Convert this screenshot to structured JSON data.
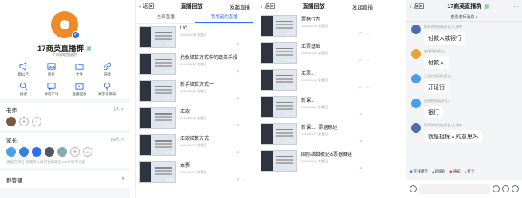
{
  "group_panel": {
    "name": "17商英直播群",
    "tag": "群",
    "subtitle": "17商英直播群",
    "tools": [
      {
        "label": "群公告",
        "icon": "megaphone-icon"
      },
      {
        "label": "图片",
        "icon": "image-icon"
      },
      {
        "label": "文件",
        "icon": "folder-icon"
      },
      {
        "label": "链接",
        "icon": "link-icon"
      },
      {
        "label": "搜索",
        "icon": "search-icon"
      },
      {
        "label": "群内广场",
        "icon": "chat-icon"
      },
      {
        "label": "直播回放",
        "icon": "video-icon"
      },
      {
        "label": "数字化教研",
        "icon": "bulb-icon"
      }
    ],
    "teachers": {
      "label": "老师",
      "count": "1人 >"
    },
    "parents": {
      "label": "家长",
      "count": "80人 >",
      "note": "该群已开启\"新成员入群可查看最近100条聊天记录\""
    },
    "manage": "群管理"
  },
  "replay_list": {
    "back": "返回",
    "title": "直播回放",
    "action": "发起直播",
    "tabs": [
      "全部直播",
      "我发起的直播"
    ],
    "items": [
      {
        "title": "L/C",
        "meta": "2020/03/25  查看回",
        "dur": "00:30"
      },
      {
        "title": "托收结算方式中的跟单手段",
        "meta": "2020/03/25  查看回",
        "dur": "00:41"
      },
      {
        "title": "新手结算方式一",
        "meta": "2020/03/25  查看回",
        "dur": "00:41"
      },
      {
        "title": "汇款",
        "meta": "2020/03/23  查看回",
        "dur": "00:24"
      },
      {
        "title": "汇款结算方式",
        "meta": "2020/03/23  查看回",
        "dur": "00:35"
      },
      {
        "title": "本票",
        "meta": "2020/03/20  查看回",
        "dur": "00:30"
      }
    ]
  },
  "replay_list2": {
    "back": "返回",
    "title": "直播回放",
    "action": "发起直播",
    "items": [
      {
        "title": "票据行为",
        "meta": "2020/03/19  查看回",
        "dur": "00:27"
      },
      {
        "title": "汇票基础",
        "meta": "2020/03/18  查看回",
        "dur": "00:31"
      },
      {
        "title": "汇票1",
        "meta": "2020/03/13  查看回",
        "dur": "00:43"
      },
      {
        "title": "新课1",
        "meta": "2020/03/12  查看回",
        "dur": "00:35"
      },
      {
        "title": "新课1：票据概述",
        "meta": "2020/03/12  查看回",
        "dur": "00:40"
      },
      {
        "title": "国际结算概述&票据概述",
        "meta": "2020/03/10  查看回",
        "dur": "00:38"
      }
    ]
  },
  "chat": {
    "back": "返回",
    "title": "17商英直播群",
    "tag": "群",
    "more": "···",
    "subtitle": "查看老师消息 >",
    "messages": [
      {
        "who": "陈同学的妈妈(家长) 上课中",
        "text": "付款人或银行",
        "color": "#4b6fae"
      },
      {
        "who": "赵瑞同学(家长)",
        "text": "付款人",
        "color": "#e8a23a"
      },
      {
        "who": "王佳艺的妈妈(家长)",
        "text": "开证行",
        "color": "#4aa0e6"
      },
      {
        "who": "吕芳的妈妈(家长)",
        "text": "银行",
        "color": "#4aa0e6"
      },
      {
        "who": "陈同学的妈妈(家长) 上课中",
        "text": "就是担保人的意思吗",
        "color": "#4b6fae"
      }
    ],
    "quick": [
      "在线课堂",
      "班级树",
      "通知",
      "打卡"
    ]
  },
  "colors": {
    "accent": "#2e6ff2",
    "brand": "#f08a24"
  }
}
